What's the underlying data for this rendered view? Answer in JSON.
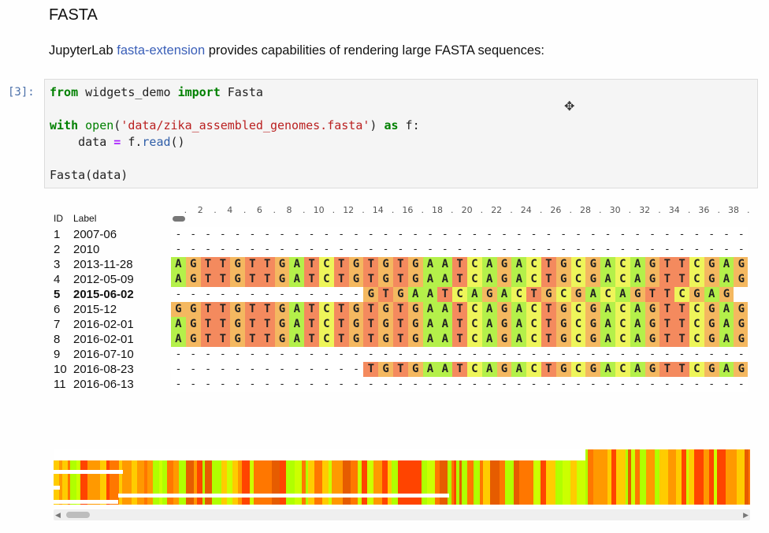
{
  "notebook": {
    "heading": "FASTA",
    "intro_prefix": "JupyterLab ",
    "intro_link": "fasta-extension",
    "intro_suffix": " provides capabilities of rendering large FASTA sequences:",
    "prompt": "[3]:",
    "code_lines": [
      [
        {
          "t": "from",
          "c": "kw"
        },
        {
          "t": " widgets_demo "
        },
        {
          "t": "import",
          "c": "kw"
        },
        {
          "t": " Fasta"
        }
      ],
      [],
      [
        {
          "t": "with",
          "c": "kw"
        },
        {
          "t": " "
        },
        {
          "t": "open",
          "c": "bi"
        },
        {
          "t": "("
        },
        {
          "t": "'data/zika_assembled_genomes.fasta'",
          "c": "str"
        },
        {
          "t": ") "
        },
        {
          "t": "as",
          "c": "kw"
        },
        {
          "t": " f:"
        }
      ],
      [
        {
          "t": "    data "
        },
        {
          "t": "=",
          "c": "op"
        },
        {
          "t": " f."
        },
        {
          "t": "read",
          "c": "fn"
        },
        {
          "t": "()"
        }
      ],
      [],
      [
        {
          "t": "Fasta(data)"
        }
      ]
    ]
  },
  "viewer": {
    "id_header": "ID",
    "label_header": "Label",
    "ruler": [
      ".",
      "2",
      ".",
      "4",
      ".",
      "6",
      ".",
      "8",
      ".",
      "10",
      ".",
      "12",
      ".",
      "14",
      ".",
      "16",
      ".",
      "18",
      ".",
      "20",
      ".",
      "22",
      ".",
      "24",
      ".",
      "26",
      ".",
      "28",
      ".",
      "30",
      ".",
      "32",
      ".",
      "34",
      ".",
      "36",
      ".",
      "38",
      "."
    ],
    "selected_row": 5,
    "rows": [
      {
        "id": "1",
        "label": "2007-06",
        "seq": "-------------------------------------------------"
      },
      {
        "id": "2",
        "label": "2010",
        "seq": "-------------------------------------------------"
      },
      {
        "id": "3",
        "label": "2013-11-28",
        "seq": "AGTTGTTGATCTGTGTGAATCAGACTGCGACAGTTCGAG"
      },
      {
        "id": "4",
        "label": "2012-05-09",
        "seq": "AGTTGTTGATCTGTGTGAATCAGACTGCGACAGTTCGAG"
      },
      {
        "id": "5",
        "label": "2015-06-02",
        "seq": "-------------GTGAATCAGACTGCGACAGTTCGAG"
      },
      {
        "id": "6",
        "label": "2015-12",
        "seq": "GGTTGTTGATCTGTGTGAATCAGACTGCGACAGTTCGAG"
      },
      {
        "id": "7",
        "label": "2016-02-01",
        "seq": "AGTTGTTGATCTGTGTGAATCAGACTGCGACAGTTCGAG"
      },
      {
        "id": "8",
        "label": "2016-02-01",
        "seq": "AGTTGTTGATCTGTGTGAATCAGACTGCGACAGTTCGAG"
      },
      {
        "id": "9",
        "label": "2016-07-10",
        "seq": "-------------------------------------------------"
      },
      {
        "id": "10",
        "label": "2016-08-23",
        "seq": "-------------TGTGAATCAGACTGCGACAGTTCGAG"
      },
      {
        "id": "11",
        "label": "2016-06-13",
        "seq": "-------------------------------------------------"
      }
    ],
    "base_colors": {
      "A": "#b4f04a",
      "T": "#f48a5e",
      "G": "#f4b860",
      "C": "#eef55a",
      "gap": "#ffffff"
    },
    "overview_colors": [
      "#ff4400",
      "#ff9900",
      "#b0ff00",
      "#ffcc00",
      "#e65c00",
      "#ccff00",
      "#ff7700"
    ],
    "scrollbar_icons": {
      "left": "triangle-left-icon",
      "right": "triangle-right-icon"
    }
  }
}
